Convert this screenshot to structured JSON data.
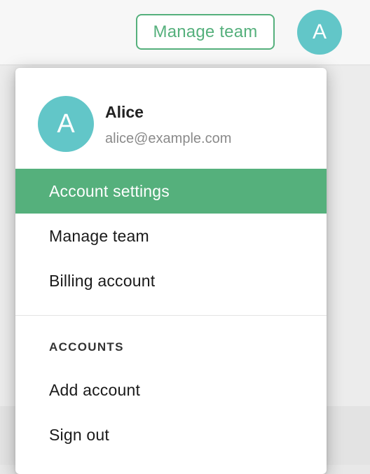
{
  "header": {
    "manage_team_label": "Manage team",
    "avatar_initial": "A"
  },
  "menu": {
    "user": {
      "name": "Alice",
      "email": "alice@example.com",
      "avatar_initial": "A"
    },
    "items": [
      {
        "label": "Account settings",
        "active": true
      },
      {
        "label": "Manage team",
        "active": false
      },
      {
        "label": "Billing account",
        "active": false
      }
    ],
    "accounts_section": {
      "label": "ACCOUNTS",
      "items": [
        {
          "label": "Add account"
        },
        {
          "label": "Sign out"
        }
      ]
    }
  },
  "colors": {
    "accent_green": "#55b07c",
    "avatar_teal": "#62c6c8"
  }
}
